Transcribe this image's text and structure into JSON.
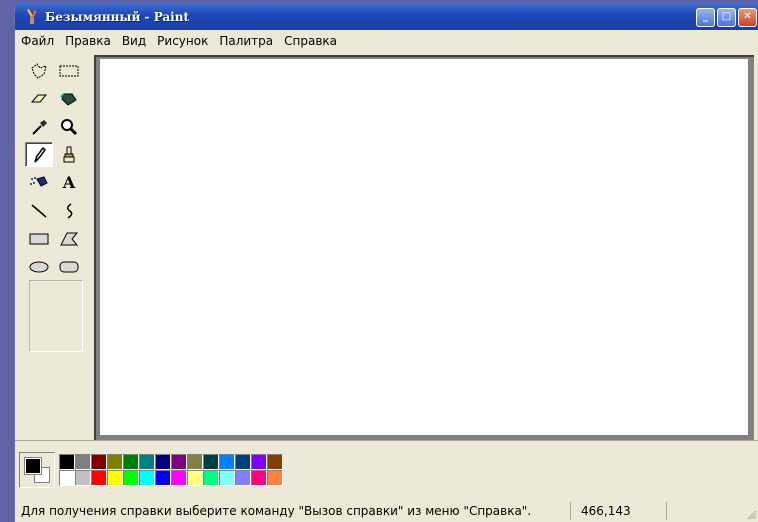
{
  "window": {
    "title": "Безымянный - Paint",
    "icon": "paint-brush-icon",
    "buttons": [
      "minimize-icon",
      "maximize-icon",
      "close-icon"
    ]
  },
  "menu": {
    "items": [
      "Файл",
      "Правка",
      "Вид",
      "Рисунок",
      "Палитра",
      "Справка"
    ]
  },
  "toolbox": {
    "tools": [
      {
        "name": "free-form-select",
        "icon": "free-select-icon"
      },
      {
        "name": "rect-select",
        "icon": "rect-select-icon"
      },
      {
        "name": "eraser",
        "icon": "eraser-icon"
      },
      {
        "name": "fill",
        "icon": "fill-bucket-icon"
      },
      {
        "name": "pick-color",
        "icon": "eyedropper-icon"
      },
      {
        "name": "magnifier",
        "icon": "magnifier-icon"
      },
      {
        "name": "pencil",
        "icon": "pencil-icon",
        "selected": true
      },
      {
        "name": "brush",
        "icon": "brush-icon"
      },
      {
        "name": "airbrush",
        "icon": "airbrush-icon"
      },
      {
        "name": "text",
        "icon": "text-icon",
        "glyph": "A"
      },
      {
        "name": "line",
        "icon": "line-icon"
      },
      {
        "name": "curve",
        "icon": "curve-icon"
      },
      {
        "name": "rectangle",
        "icon": "rectangle-icon"
      },
      {
        "name": "polygon",
        "icon": "polygon-icon"
      },
      {
        "name": "ellipse",
        "icon": "ellipse-icon"
      },
      {
        "name": "rounded-rectangle",
        "icon": "rounded-rect-icon"
      }
    ]
  },
  "palette": {
    "foreground": "#000000",
    "background": "#ffffff",
    "row1": [
      "#000000",
      "#808080",
      "#800000",
      "#808000",
      "#008000",
      "#008080",
      "#000080",
      "#800080",
      "#808040",
      "#004040",
      "#0080ff",
      "#004080",
      "#8000ff",
      "#804000"
    ],
    "row2": [
      "#ffffff",
      "#c0c0c0",
      "#ff0000",
      "#ffff00",
      "#00ff00",
      "#00ffff",
      "#0000ff",
      "#ff00ff",
      "#ffff80",
      "#00ff80",
      "#80ffff",
      "#8080ff",
      "#ff0080",
      "#ff8040"
    ]
  },
  "status": {
    "help_text": "Для получения справки выберите команду \"Вызов справки\" из меню \"Справка\".",
    "coords": "466,143"
  }
}
